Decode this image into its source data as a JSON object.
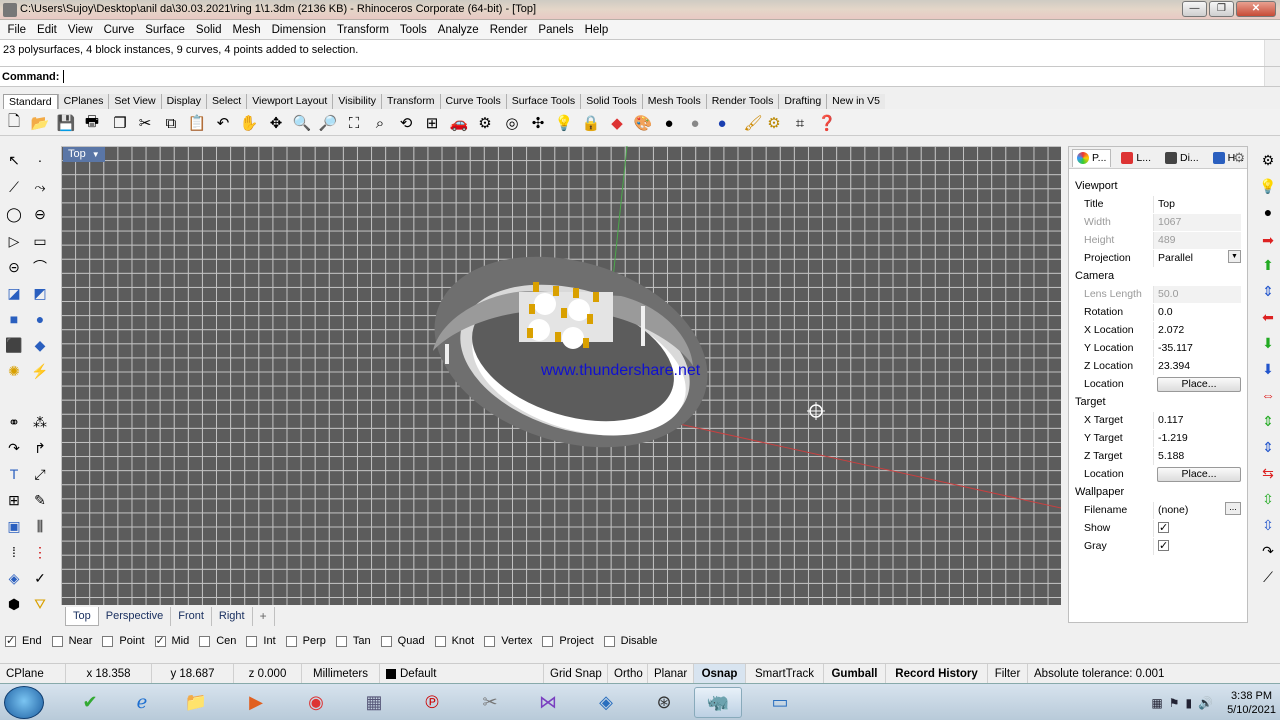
{
  "window": {
    "title": "C:\\Users\\Sujoy\\Desktop\\anil da\\30.03.2021\\ring 1\\1.3dm (2136 KB) - Rhinoceros Corporate (64-bit) - [Top]",
    "minimize": "—",
    "maximize": "❐",
    "close": "✕"
  },
  "menu": [
    "File",
    "Edit",
    "View",
    "Curve",
    "Surface",
    "Solid",
    "Mesh",
    "Dimension",
    "Transform",
    "Tools",
    "Analyze",
    "Render",
    "Panels",
    "Help"
  ],
  "command": {
    "history": "23 polysurfaces, 4 block instances, 9 curves, 4 points added to selection.",
    "label": "Command:",
    "value": ""
  },
  "toolbar_tabs": [
    "Standard",
    "CPlanes",
    "Set View",
    "Display",
    "Select",
    "Viewport Layout",
    "Visibility",
    "Transform",
    "Curve Tools",
    "Surface Tools",
    "Solid Tools",
    "Mesh Tools",
    "Render Tools",
    "Drafting",
    "New in V5"
  ],
  "toolbar_icons": [
    "new-icon",
    "open-icon",
    "save-icon",
    "print-icon",
    "template-icon",
    "cut-icon",
    "copy-icon",
    "paste-icon",
    "undo-icon",
    "pan-icon",
    "rotate-view-icon",
    "zoom-icon",
    "zoom-window-icon",
    "zoom-extents-icon",
    "zoom-selected-icon",
    "undo-view-icon",
    "four-viewports-icon",
    "car-icon",
    "properties-icon",
    "select-icon",
    "snap-icon",
    "light-icon",
    "lock-icon",
    "layer-icon",
    "color-wheel-icon",
    "shaded-sphere-icon",
    "rendered-sphere-icon",
    "blue-sphere-icon",
    "material-icon",
    "settings-icon",
    "gumball-icon",
    "help-icon"
  ],
  "viewport": {
    "name": "Top",
    "watermark": "www.thundershare.net",
    "tabs": [
      "Top",
      "Perspective",
      "Front",
      "Right",
      "+"
    ]
  },
  "osnaps": [
    {
      "label": "End",
      "checked": true
    },
    {
      "label": "Near",
      "checked": false
    },
    {
      "label": "Point",
      "checked": false
    },
    {
      "label": "Mid",
      "checked": true
    },
    {
      "label": "Cen",
      "checked": false
    },
    {
      "label": "Int",
      "checked": false
    },
    {
      "label": "Perp",
      "checked": false
    },
    {
      "label": "Tan",
      "checked": false
    },
    {
      "label": "Quad",
      "checked": false
    },
    {
      "label": "Knot",
      "checked": false
    },
    {
      "label": "Vertex",
      "checked": false
    },
    {
      "label": "Project",
      "checked": false
    },
    {
      "label": "Disable",
      "checked": false
    }
  ],
  "status": {
    "cplane": "CPlane",
    "x": "x 18.358",
    "y": "y 18.687",
    "z": "z 0.000",
    "units": "Millimeters",
    "layer": "Default",
    "grid_snap": "Grid Snap",
    "ortho": "Ortho",
    "planar": "Planar",
    "osnap": "Osnap",
    "smarttrack": "SmartTrack",
    "gumball": "Gumball",
    "record_history": "Record History",
    "filter": "Filter",
    "tolerance": "Absolute tolerance: 0.001"
  },
  "panel": {
    "tabs": [
      "P...",
      "L...",
      "Di...",
      "H..."
    ],
    "viewport_header": "Viewport",
    "title_k": "Title",
    "title_v": "Top",
    "width_k": "Width",
    "width_v": "1067",
    "height_k": "Height",
    "height_v": "489",
    "projection_k": "Projection",
    "projection_v": "Parallel",
    "camera_header": "Camera",
    "lens_k": "Lens Length",
    "lens_v": "50.0",
    "rotation_k": "Rotation",
    "rotation_v": "0.0",
    "xloc_k": "X Location",
    "xloc_v": "2.072",
    "yloc_k": "Y Location",
    "yloc_v": "-35.117",
    "zloc_k": "Z Location",
    "zloc_v": "23.394",
    "loc_k": "Location",
    "place": "Place...",
    "target_header": "Target",
    "xt_k": "X Target",
    "xt_v": "0.117",
    "yt_k": "Y Target",
    "yt_v": "-1.219",
    "zt_k": "Z Target",
    "zt_v": "5.188",
    "tloc_k": "Location",
    "wallpaper_header": "Wallpaper",
    "file_k": "Filename",
    "file_v": "(none)",
    "show_k": "Show",
    "gray_k": "Gray"
  },
  "taskbar": {
    "time": "3:38 PM",
    "date": "5/10/2021"
  }
}
